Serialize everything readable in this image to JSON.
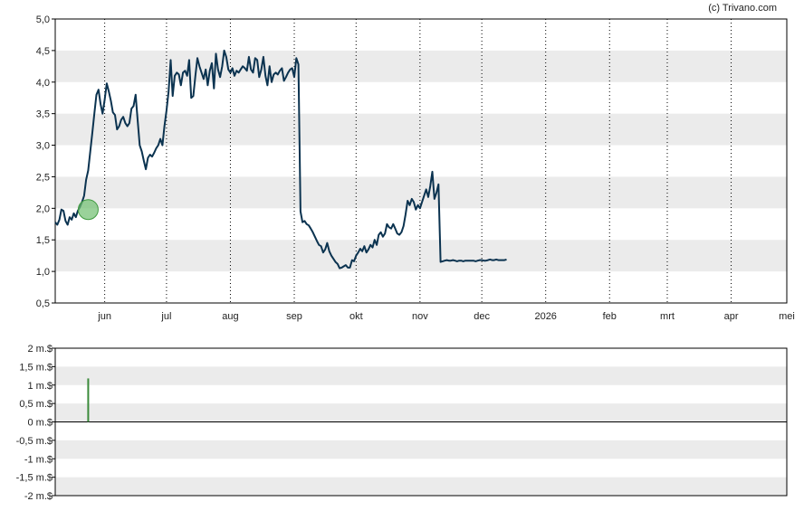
{
  "credit": "(c) Trivano.com",
  "colors": {
    "price_line": "#0b3350",
    "band": "#ebebeb",
    "marker_fill": "#6fbf6f",
    "marker_stroke": "#3f9a3f",
    "volume_bar": "#3a8a3a",
    "grid": "#000000"
  },
  "chart_data": [
    {
      "type": "line",
      "title": "",
      "ylabel": "",
      "ylim": [
        0.5,
        5.0
      ],
      "y_ticks": [
        "0,5",
        "1,0",
        "1,5",
        "2,0",
        "2,5",
        "3,0",
        "3,5",
        "4,0",
        "4,5",
        "5,0"
      ],
      "y_tick_values": [
        0.5,
        1.0,
        1.5,
        2.0,
        2.5,
        3.0,
        3.5,
        4.0,
        4.5,
        5.0
      ],
      "x_axis_unit": "days since 2025-05-15",
      "xlim": [
        0,
        355
      ],
      "x_ticks": [
        {
          "label": "jun",
          "x": 24
        },
        {
          "label": "jul",
          "x": 54
        },
        {
          "label": "aug",
          "x": 85
        },
        {
          "label": "sep",
          "x": 116
        },
        {
          "label": "okt",
          "x": 146
        },
        {
          "label": "nov",
          "x": 177
        },
        {
          "label": "dec",
          "x": 207
        },
        {
          "label": "2026",
          "x": 238
        },
        {
          "label": "feb",
          "x": 269
        },
        {
          "label": "mrt",
          "x": 297
        },
        {
          "label": "apr",
          "x": 328
        },
        {
          "label": "mei",
          "x": 355
        }
      ],
      "grid": "vertical dotted lines at month boundaries, alternating horizontal bands",
      "marker": {
        "x": 16,
        "y": 1.98
      },
      "series": [
        {
          "name": "",
          "points": [
            [
              0,
              1.78
            ],
            [
              1,
              1.74
            ],
            [
              2,
              1.82
            ],
            [
              3,
              1.98
            ],
            [
              4,
              1.96
            ],
            [
              5,
              1.8
            ],
            [
              6,
              1.74
            ],
            [
              7,
              1.86
            ],
            [
              8,
              1.82
            ],
            [
              9,
              1.92
            ],
            [
              10,
              1.86
            ],
            [
              11,
              1.96
            ],
            [
              12,
              2.02
            ],
            [
              13,
              2.1
            ],
            [
              14,
              2.2
            ],
            [
              15,
              2.45
            ],
            [
              16,
              2.6
            ],
            [
              17,
              2.9
            ],
            [
              18,
              3.2
            ],
            [
              19,
              3.5
            ],
            [
              20,
              3.8
            ],
            [
              21,
              3.88
            ],
            [
              22,
              3.65
            ],
            [
              23,
              3.5
            ],
            [
              24,
              3.72
            ],
            [
              25,
              3.98
            ],
            [
              26,
              3.85
            ],
            [
              27,
              3.7
            ],
            [
              28,
              3.52
            ],
            [
              29,
              3.48
            ],
            [
              30,
              3.25
            ],
            [
              31,
              3.3
            ],
            [
              32,
              3.4
            ],
            [
              33,
              3.45
            ],
            [
              34,
              3.35
            ],
            [
              35,
              3.3
            ],
            [
              36,
              3.35
            ],
            [
              37,
              3.58
            ],
            [
              38,
              3.62
            ],
            [
              39,
              3.8
            ],
            [
              40,
              3.4
            ],
            [
              41,
              3.0
            ],
            [
              42,
              2.9
            ],
            [
              43,
              2.75
            ],
            [
              44,
              2.62
            ],
            [
              45,
              2.8
            ],
            [
              46,
              2.85
            ],
            [
              47,
              2.82
            ],
            [
              48,
              2.88
            ],
            [
              49,
              2.95
            ],
            [
              50,
              3.0
            ],
            [
              51,
              3.1
            ],
            [
              52,
              3.0
            ],
            [
              53,
              3.3
            ],
            [
              54,
              3.55
            ],
            [
              55,
              3.85
            ],
            [
              56,
              4.35
            ],
            [
              57,
              3.78
            ],
            [
              58,
              4.1
            ],
            [
              59,
              4.15
            ],
            [
              60,
              4.12
            ],
            [
              61,
              3.95
            ],
            [
              62,
              4.15
            ],
            [
              63,
              4.18
            ],
            [
              64,
              4.1
            ],
            [
              65,
              4.35
            ],
            [
              66,
              3.75
            ],
            [
              67,
              3.78
            ],
            [
              68,
              4.1
            ],
            [
              69,
              4.38
            ],
            [
              70,
              4.25
            ],
            [
              71,
              4.15
            ],
            [
              72,
              4.05
            ],
            [
              73,
              4.2
            ],
            [
              74,
              3.95
            ],
            [
              75,
              4.18
            ],
            [
              76,
              4.3
            ],
            [
              77,
              3.9
            ],
            [
              78,
              4.45
            ],
            [
              79,
              4.2
            ],
            [
              80,
              4.08
            ],
            [
              81,
              4.25
            ],
            [
              82,
              4.5
            ],
            [
              83,
              4.4
            ],
            [
              84,
              4.2
            ],
            [
              85,
              4.15
            ],
            [
              86,
              4.22
            ],
            [
              87,
              4.1
            ],
            [
              88,
              4.18
            ],
            [
              89,
              4.15
            ],
            [
              90,
              4.2
            ],
            [
              91,
              4.25
            ],
            [
              92,
              4.22
            ],
            [
              93,
              4.18
            ],
            [
              94,
              4.4
            ],
            [
              95,
              4.2
            ],
            [
              96,
              4.15
            ],
            [
              97,
              4.38
            ],
            [
              98,
              4.35
            ],
            [
              99,
              4.08
            ],
            [
              100,
              4.2
            ],
            [
              101,
              4.4
            ],
            [
              102,
              4.1
            ],
            [
              103,
              3.95
            ],
            [
              104,
              4.25
            ],
            [
              105,
              4.0
            ],
            [
              106,
              4.12
            ],
            [
              107,
              4.15
            ],
            [
              108,
              4.12
            ],
            [
              109,
              4.18
            ],
            [
              110,
              4.22
            ],
            [
              111,
              4.02
            ],
            [
              112,
              4.08
            ],
            [
              113,
              4.15
            ],
            [
              114,
              4.2
            ],
            [
              115,
              4.22
            ],
            [
              116,
              4.08
            ],
            [
              117,
              4.38
            ],
            [
              118,
              4.28
            ],
            [
              119,
              1.95
            ],
            [
              120,
              1.78
            ],
            [
              121,
              1.8
            ],
            [
              122,
              1.75
            ],
            [
              123,
              1.73
            ],
            [
              124,
              1.68
            ],
            [
              125,
              1.62
            ],
            [
              126,
              1.55
            ],
            [
              127,
              1.48
            ],
            [
              128,
              1.42
            ],
            [
              129,
              1.4
            ],
            [
              130,
              1.3
            ],
            [
              131,
              1.35
            ],
            [
              132,
              1.45
            ],
            [
              133,
              1.32
            ],
            [
              134,
              1.25
            ],
            [
              135,
              1.2
            ],
            [
              136,
              1.15
            ],
            [
              137,
              1.12
            ],
            [
              138,
              1.05
            ],
            [
              139,
              1.06
            ],
            [
              140,
              1.08
            ],
            [
              141,
              1.1
            ],
            [
              142,
              1.06
            ],
            [
              143,
              1.06
            ],
            [
              144,
              1.18
            ],
            [
              145,
              1.16
            ],
            [
              146,
              1.25
            ],
            [
              147,
              1.3
            ],
            [
              148,
              1.36
            ],
            [
              149,
              1.32
            ],
            [
              150,
              1.4
            ],
            [
              151,
              1.3
            ],
            [
              152,
              1.35
            ],
            [
              153,
              1.42
            ],
            [
              154,
              1.38
            ],
            [
              155,
              1.5
            ],
            [
              156,
              1.42
            ],
            [
              157,
              1.58
            ],
            [
              158,
              1.62
            ],
            [
              159,
              1.55
            ],
            [
              160,
              1.6
            ],
            [
              161,
              1.75
            ],
            [
              162,
              1.7
            ],
            [
              163,
              1.68
            ],
            [
              164,
              1.75
            ],
            [
              165,
              1.68
            ],
            [
              166,
              1.6
            ],
            [
              167,
              1.58
            ],
            [
              168,
              1.62
            ],
            [
              169,
              1.72
            ],
            [
              170,
              1.9
            ],
            [
              171,
              2.12
            ],
            [
              172,
              2.05
            ],
            [
              173,
              2.15
            ],
            [
              174,
              2.1
            ],
            [
              175,
              1.98
            ],
            [
              176,
              2.05
            ],
            [
              177,
              2.0
            ],
            [
              178,
              2.1
            ],
            [
              179,
              2.2
            ],
            [
              180,
              2.3
            ],
            [
              181,
              2.18
            ],
            [
              182,
              2.35
            ],
            [
              183,
              2.58
            ],
            [
              184,
              2.15
            ],
            [
              185,
              2.25
            ],
            [
              186,
              2.38
            ],
            [
              187,
              1.15
            ],
            [
              188,
              1.16
            ],
            [
              189,
              1.17
            ],
            [
              190,
              1.18
            ],
            [
              191,
              1.17
            ],
            [
              192,
              1.17
            ],
            [
              193,
              1.18
            ],
            [
              194,
              1.17
            ],
            [
              195,
              1.16
            ],
            [
              196,
              1.17
            ],
            [
              197,
              1.17
            ],
            [
              198,
              1.16
            ],
            [
              199,
              1.17
            ],
            [
              200,
              1.17
            ],
            [
              201,
              1.17
            ],
            [
              202,
              1.17
            ],
            [
              203,
              1.17
            ],
            [
              204,
              1.16
            ],
            [
              205,
              1.17
            ],
            [
              206,
              1.18
            ],
            [
              207,
              1.18
            ],
            [
              208,
              1.17
            ],
            [
              209,
              1.17
            ],
            [
              210,
              1.18
            ],
            [
              211,
              1.19
            ],
            [
              212,
              1.18
            ],
            [
              213,
              1.18
            ],
            [
              214,
              1.19
            ],
            [
              215,
              1.18
            ],
            [
              216,
              1.18
            ],
            [
              217,
              1.18
            ],
            [
              218,
              1.18
            ],
            [
              219,
              1.19
            ]
          ]
        }
      ]
    },
    {
      "type": "bar",
      "title": "",
      "ylabel": "",
      "ylim": [
        -2,
        2
      ],
      "y_ticks": [
        "-2 m.$",
        "-1,5 m.$",
        "-1 m.$",
        "-0,5 m.$",
        "0 m.$",
        "0,5 m.$",
        "1 m.$",
        "1,5 m.$",
        "2 m.$"
      ],
      "y_tick_values": [
        -2,
        -1.5,
        -1,
        -0.5,
        0,
        0.5,
        1,
        1.5,
        2
      ],
      "x_axis_unit": "days since 2025-05-15",
      "xlim": [
        0,
        355
      ],
      "bars": [
        {
          "x": 16,
          "value": 1.18
        }
      ]
    }
  ]
}
